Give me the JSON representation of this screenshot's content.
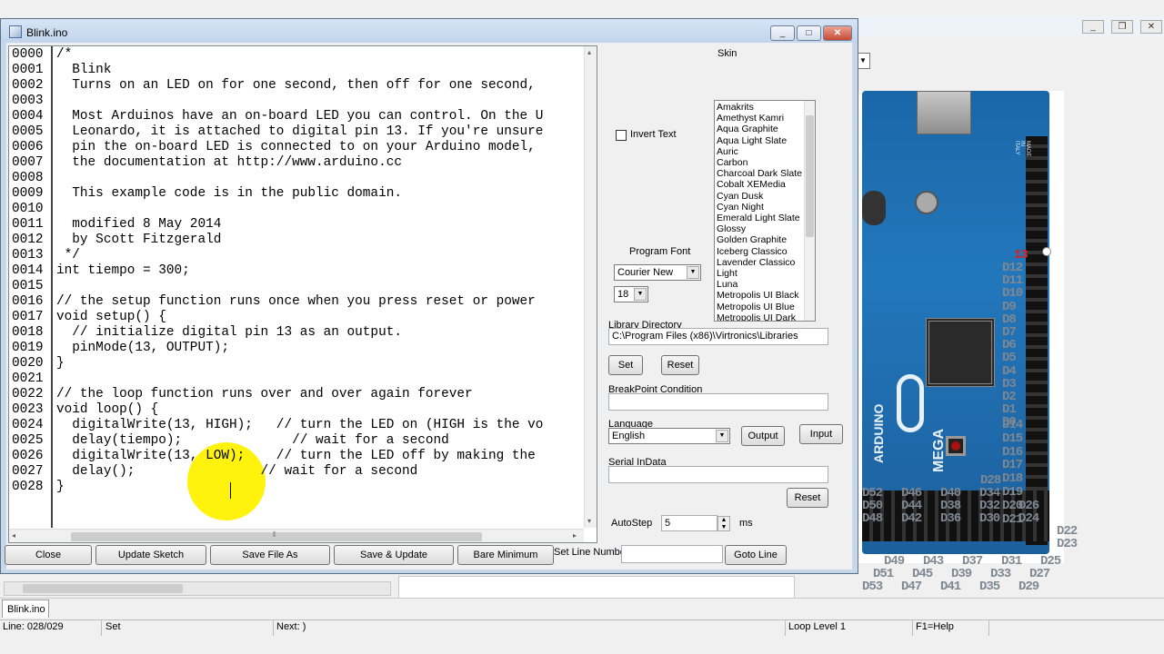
{
  "window": {
    "title": "Blink.ino",
    "min": "_",
    "max": "□",
    "close": "✕"
  },
  "bg_window": {
    "min": "_",
    "restore": "❐",
    "close": "✕",
    "dropdown_arrow": "▼"
  },
  "editor": {
    "line_numbers": [
      "0000",
      "0001",
      "0002",
      "0003",
      "0004",
      "0005",
      "0006",
      "0007",
      "0008",
      "0009",
      "0010",
      "0011",
      "0012",
      "0013",
      "0014",
      "0015",
      "0016",
      "0017",
      "0018",
      "0019",
      "0020",
      "0021",
      "0022",
      "0023",
      "0024",
      "0025",
      "0026",
      "0027",
      "0028"
    ],
    "lines": [
      "/*",
      "  Blink",
      "  Turns on an LED on for one second, then off for one second,",
      "",
      "  Most Arduinos have an on-board LED you can control. On the U",
      "  Leonardo, it is attached to digital pin 13. If you're unsure",
      "  pin the on-board LED is connected to on your Arduino model,",
      "  the documentation at http://www.arduino.cc",
      "",
      "  This example code is in the public domain.",
      "",
      "  modified 8 May 2014",
      "  by Scott Fitzgerald",
      " */",
      "int tiempo = 300;",
      "",
      "// the setup function runs once when you press reset or power",
      "void setup() {",
      "  // initialize digital pin 13 as an output.",
      "  pinMode(13, OUTPUT);",
      "}",
      "",
      "// the loop function runs over and over again forever",
      "void loop() {",
      "  digitalWrite(13, HIGH);   // turn the LED on (HIGH is the vo",
      "  delay(tiempo);              // wait for a second",
      "  digitalWrite(13, LOW);    // turn the LED off by making the",
      "  delay();                // wait for a second",
      "}"
    ],
    "scroll_left": "◂",
    "scroll_right": "▸",
    "scroll_up": "▴",
    "scroll_down": "▾",
    "grip": "⦀"
  },
  "settings": {
    "skin_label": "Skin",
    "invert_text": "Invert Text",
    "skins": [
      "Amakrits",
      "Amethyst Kamri",
      "Aqua Graphite",
      "Aqua Light Slate",
      "Auric",
      "Carbon",
      "Charcoal Dark Slate",
      "Cobalt XEMedia",
      "Cyan Dusk",
      "Cyan Night",
      "Emerald Light Slate",
      "Glossy",
      "Golden Graphite",
      "Iceberg Classico",
      "Lavender Classico",
      "Light",
      "Luna",
      "Metropolis UI Black",
      "Metropolis UI Blue",
      "Metropolis UI Dark"
    ],
    "program_font_label": "Program Font",
    "font_name": "Courier New",
    "font_size": "18",
    "library_dir_label": "Library Directory",
    "library_dir": "C:\\Program Files (x86)\\Virtronics\\Libraries",
    "set_button": "Set",
    "reset_button": "Reset",
    "breakpoint_label": "BreakPoint Condition",
    "breakpoint_value": "",
    "language_label": "Language",
    "language": "English",
    "output_button": "Output",
    "input_button": "Input",
    "serial_label": "Serial InData",
    "serial_value": "",
    "reset2_button": "Reset",
    "autostep_label": "AutoStep",
    "autostep_value": "5",
    "autostep_unit": "ms",
    "dd_arrow": "▼"
  },
  "bottom_buttons": {
    "close": "Close",
    "update_sketch": "Update Sketch",
    "save_file_as": "Save File As",
    "save_update": "Save & Update",
    "bare_minimum": "Bare Minimum",
    "set_line_number": "Set Line Number",
    "line_number_value": "",
    "goto_line": "Goto Line"
  },
  "board": {
    "pin_labels_right": [
      "D12",
      "D11",
      "D10",
      "D9",
      "D8",
      "D7",
      "D6",
      "D5",
      "D4",
      "D3",
      "D2",
      "D1",
      "D0",
      "D14",
      "D15",
      "D16",
      "D17",
      "D18",
      "D19",
      "D20",
      "D21"
    ],
    "pin13": "13",
    "row_a": [
      "D52",
      "D46",
      "D40",
      "D34"
    ],
    "row_b": [
      "D50",
      "D44",
      "D38",
      "D32",
      "D26"
    ],
    "row_c": [
      "D48",
      "D42",
      "D36",
      "D30",
      "D24"
    ],
    "d28": "D28",
    "d22": "D22",
    "d23": "D23",
    "row_d": [
      "D49",
      "D43",
      "D37",
      "D31",
      "D25"
    ],
    "row_e": [
      "D51",
      "D45",
      "D39",
      "D33",
      "D27"
    ],
    "row_f": [
      "D53",
      "D47",
      "D41",
      "D35",
      "D29"
    ],
    "brand": "ARDUINO",
    "model": "MEGA",
    "made_in": "MADE IN ITALY"
  },
  "bottom_tab": "Blink.ino",
  "status": {
    "line": "Line: 028/029",
    "mode": "Set",
    "next": "Next: )",
    "loop": "Loop Level 1",
    "help": "F1=Help"
  }
}
